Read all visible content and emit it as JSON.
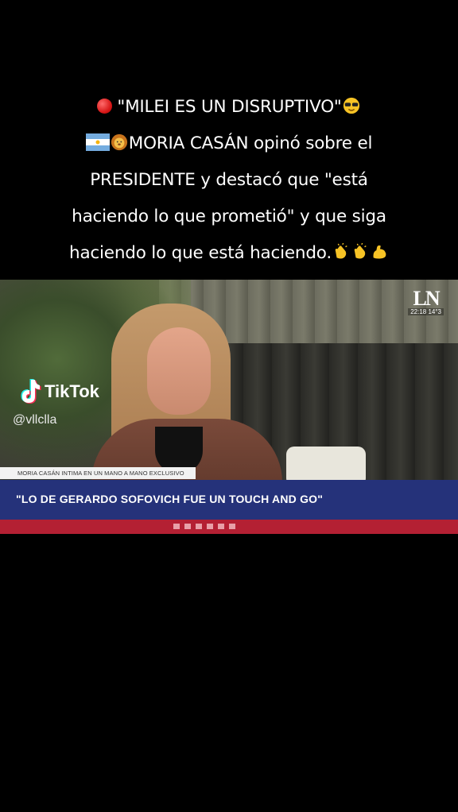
{
  "caption": {
    "line1": "\"MILEI ES UN DISRUPTIVO\"",
    "line2": "MORIA CASÁN opinó sobre el",
    "line3": "PRESIDENTE y destacó que \"está",
    "line4": "haciendo lo que prometió\" y que siga",
    "line5": "haciendo lo que está haciendo."
  },
  "icons": [
    "red-circle-icon",
    "sunglasses-face-icon",
    "argentina-flag-icon",
    "lion-face-icon",
    "clapping-hands-icon",
    "flexed-biceps-icon",
    "tiktok-logo-icon"
  ],
  "video": {
    "channel_logo": "LN",
    "channel_time": "22:18  14°3",
    "watermark_brand": "TikTok",
    "watermark_handle": "@vllclla",
    "lower_third_small": "MORIA CASÁN INTIMA EN UN MANO A MANO EXCLUSIVO",
    "lower_third_main": "\"LO DE GERARDO SOFOVICH FUE UN TOUCH AND GO\""
  },
  "colors": {
    "background": "#000000",
    "lower_third_bar": "#25327a",
    "ticker": "#b42033"
  }
}
